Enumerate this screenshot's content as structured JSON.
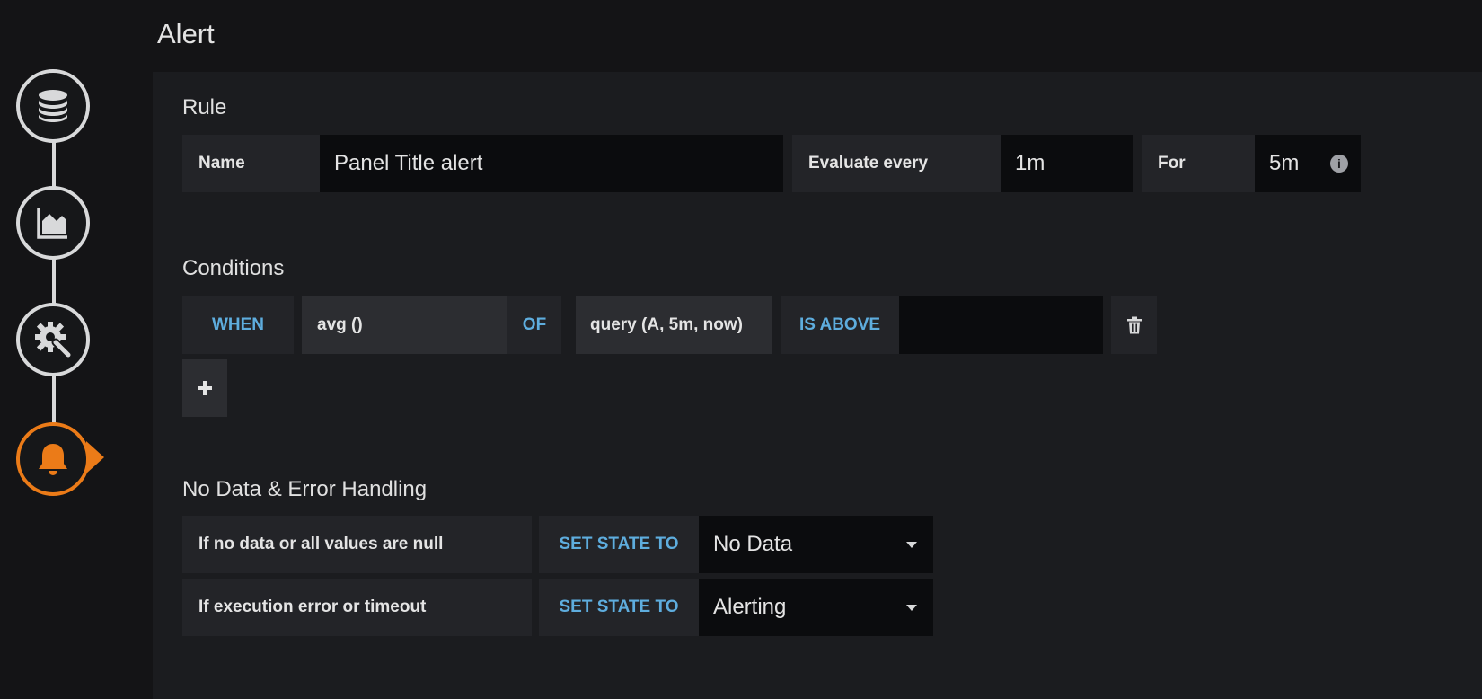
{
  "page": {
    "title": "Alert"
  },
  "steps": [
    {
      "icon": "database-icon",
      "active": false
    },
    {
      "icon": "area-chart-icon",
      "active": false
    },
    {
      "icon": "settings-icon",
      "active": false
    },
    {
      "icon": "bell-icon",
      "active": true
    }
  ],
  "rule": {
    "heading": "Rule",
    "name_label": "Name",
    "name_value": "Panel Title alert",
    "evaluate_label": "Evaluate every",
    "evaluate_value": "1m",
    "for_label": "For",
    "for_value": "5m",
    "info_icon": "info-icon"
  },
  "conditions": {
    "heading": "Conditions",
    "when_label": "WHEN",
    "reducer": "avg ()",
    "of_label": "OF",
    "query": "query (A, 5m, now)",
    "evaluator": "IS ABOVE",
    "threshold_value": "",
    "delete_icon": "trash-icon",
    "add_icon": "plus-icon"
  },
  "no_data": {
    "heading": "No Data & Error Handling",
    "rows": [
      {
        "label": "If no data or all values are null",
        "keyword": "SET STATE TO",
        "value": "No Data"
      },
      {
        "label": "If execution error or timeout",
        "keyword": "SET STATE TO",
        "value": "Alerting"
      }
    ]
  },
  "colors": {
    "accent": "#eb7b18",
    "keyword": "#5eadde",
    "background": "#141416",
    "panel": "#1b1c1f"
  }
}
